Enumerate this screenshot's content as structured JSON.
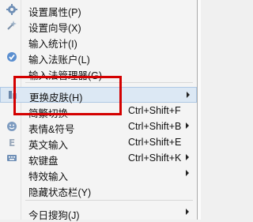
{
  "menu": {
    "items": [
      {
        "label": "设置属性(P)",
        "icon": "gear-icon"
      },
      {
        "label": "设置向导(X)",
        "icon": "wand-icon"
      },
      {
        "label": "输入统计(I)",
        "icon": ""
      },
      {
        "label": "输入法账户(L)",
        "icon": "check-circle-icon"
      },
      {
        "label": "输入法管理器(G)",
        "icon": ""
      },
      {
        "label": "更换皮肤(H)",
        "icon": "skin-icon",
        "submenu": true,
        "highlighted": true
      },
      {
        "label": "简繁切换",
        "shortcut": "Ctrl+Shift+F",
        "icon": ""
      },
      {
        "label": "表情&符号",
        "shortcut": "Ctrl+Shift+B",
        "icon": "smiley-icon",
        "submenu": true
      },
      {
        "label": "英文输入",
        "shortcut": "Ctrl+Shift+E",
        "icon": "english-icon"
      },
      {
        "label": "软键盘",
        "shortcut": "Ctrl+Shift+K",
        "icon": "keyboard-icon",
        "submenu": true
      },
      {
        "label": "特效输入",
        "icon": "",
        "submenu": true
      },
      {
        "label": "隐藏状态栏(Y)",
        "icon": ""
      },
      {
        "label": "今日搜狗(J)",
        "icon": "",
        "submenu": true
      }
    ]
  },
  "colors": {
    "highlight_border": "#d40000",
    "hover_background": "#dce8f4"
  }
}
